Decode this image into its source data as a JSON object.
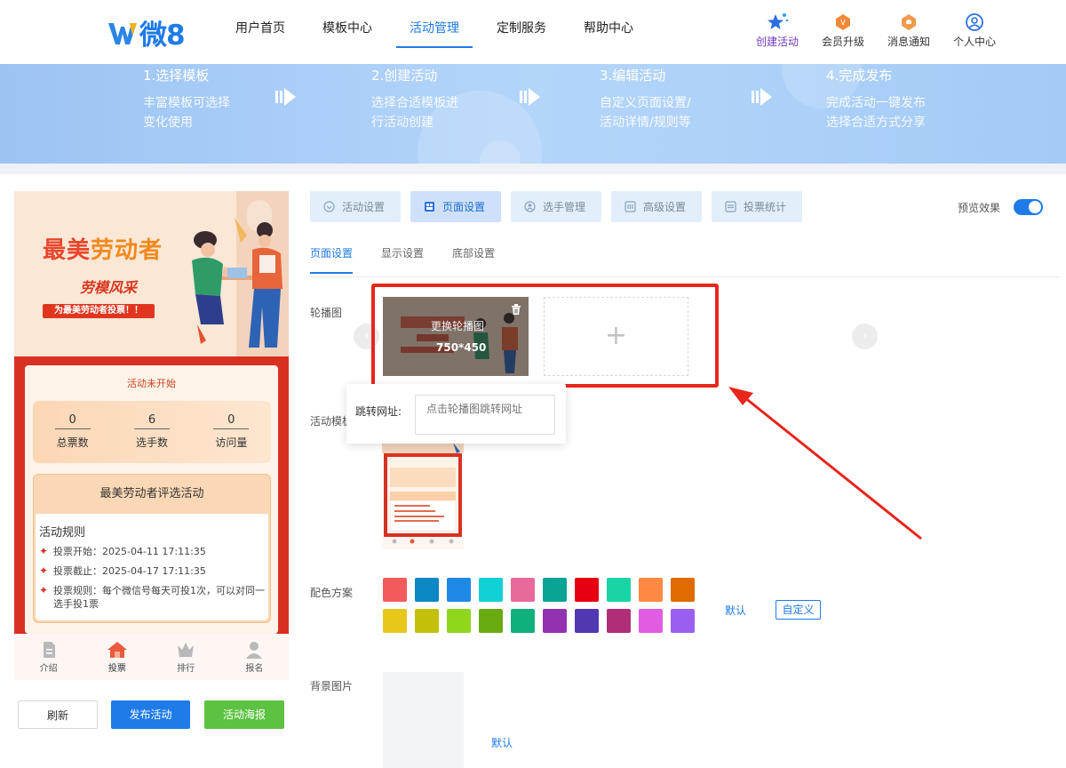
{
  "header": {
    "logo_text": "微8",
    "nav": [
      {
        "label": "用户首页",
        "active": false
      },
      {
        "label": "模板中心",
        "active": false
      },
      {
        "label": "活动管理",
        "active": true
      },
      {
        "label": "定制服务",
        "active": false
      },
      {
        "label": "帮助中心",
        "active": false
      }
    ],
    "tools": [
      {
        "label": "创建活动",
        "icon": "star-icon"
      },
      {
        "label": "会员升级",
        "icon": "vip-badge-icon"
      },
      {
        "label": "消息通知",
        "icon": "bell-badge-icon"
      },
      {
        "label": "个人中心",
        "icon": "user-icon"
      }
    ]
  },
  "steps": [
    {
      "title": "1.选择模板",
      "desc1": "丰富模板可选择",
      "desc2": "变化使用"
    },
    {
      "title": "2.创建活动",
      "desc1": "选择合适模板进",
      "desc2": "行活动创建"
    },
    {
      "title": "3.编辑活动",
      "desc1": "自定义页面设置/",
      "desc2": "活动详情/规则等"
    },
    {
      "title": "4.完成发布",
      "desc1": "完成活动一键发布",
      "desc2": "选择合适方式分享"
    }
  ],
  "phone": {
    "banner_title_a": "最美",
    "banner_title_b": "劳动者",
    "banner_sub": "劳模风采",
    "banner_tag": "为最美劳动者投票！！",
    "status": "活动未开始",
    "stats": [
      {
        "value": "0",
        "label": "总票数"
      },
      {
        "value": "6",
        "label": "选手数"
      },
      {
        "value": "0",
        "label": "访问量"
      }
    ],
    "rules_title": "最美劳动者评选活动",
    "rules_heading": "活动规则",
    "rules": [
      "投票开始：2025-04-11 17:11:35",
      "投票截止：2025-04-17 17:11:35",
      "投票规则：每个微信号每天可投1次，可以对同一选手投1票"
    ],
    "tabs": [
      {
        "label": "介绍",
        "icon": "document-icon"
      },
      {
        "label": "投票",
        "icon": "home-icon"
      },
      {
        "label": "排行",
        "icon": "crown-icon"
      },
      {
        "label": "报名",
        "icon": "person-icon"
      }
    ]
  },
  "buttons": {
    "refresh": "刷新",
    "publish": "发布活动",
    "poster": "活动海报"
  },
  "settings_tabs": [
    {
      "label": "活动设置",
      "active": false
    },
    {
      "label": "页面设置",
      "active": true
    },
    {
      "label": "选手管理",
      "active": false
    },
    {
      "label": "高级设置",
      "active": false
    },
    {
      "label": "投票统计",
      "active": false
    }
  ],
  "preview_toggle": {
    "label": "预览效果",
    "on": true
  },
  "sub_tabs": [
    {
      "label": "页面设置",
      "active": true
    },
    {
      "label": "显示设置",
      "active": false
    },
    {
      "label": "底部设置",
      "active": false
    }
  ],
  "carousel": {
    "label": "轮播图",
    "replace_text": "更换轮播图",
    "size_text": "750*450",
    "add_symbol": "+"
  },
  "jump_popup": {
    "label": "跳转网址:",
    "placeholder": "点击轮播图跳转网址"
  },
  "template_label": "活动模板",
  "color_scheme": {
    "label": "配色方案",
    "colors": [
      "#f25b5b",
      "#0b87c4",
      "#1e88e5",
      "#11d1d6",
      "#e86a9b",
      "#0aa394",
      "#e60012",
      "#19d4a4",
      "#ff8842",
      "#e06b00",
      "#e8c71b",
      "#c3c00a",
      "#8fd61c",
      "#6aab12",
      "#10b07c",
      "#9232b0",
      "#5237b2",
      "#b02e78",
      "#e15ce0",
      "#9a5ef0"
    ],
    "default_label": "默认",
    "custom_label": "自定义"
  },
  "background": {
    "label": "背景图片",
    "default_label": "默认"
  }
}
